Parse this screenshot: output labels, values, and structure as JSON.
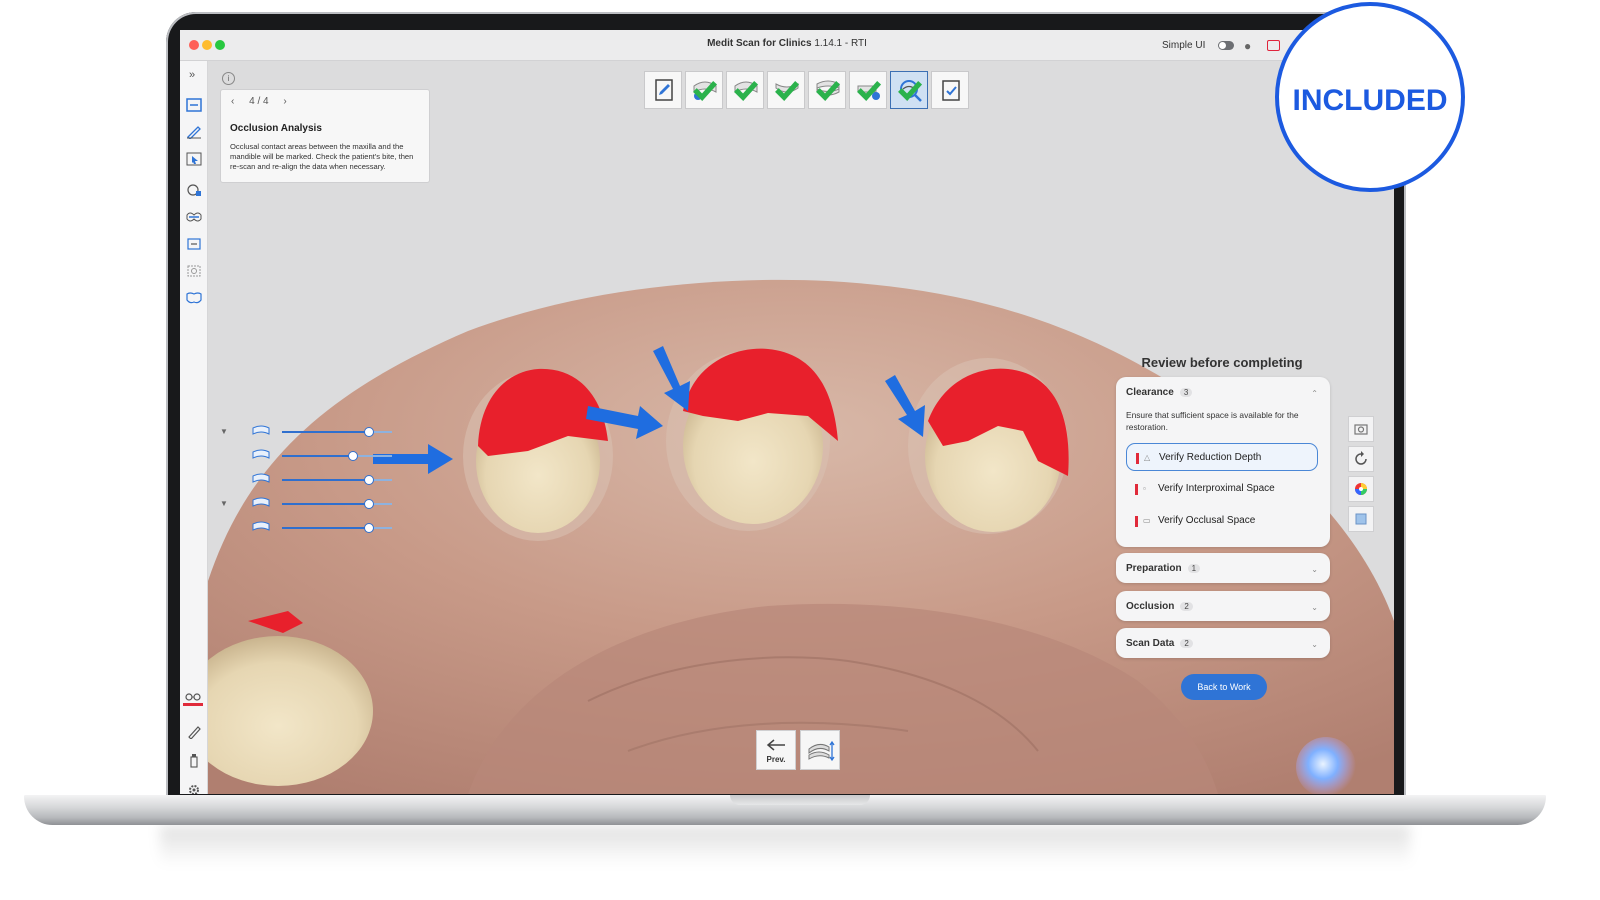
{
  "window": {
    "title_bold": "Medit Scan for Clinics",
    "title_rest": "1.14.1 - RTI",
    "simple_ui_label": "Simple UI",
    "traffic_lights": [
      "#fe5f57",
      "#febc2e",
      "#28c840"
    ]
  },
  "sidebar": {
    "expand_icon": "»",
    "top_items": [
      "scan-icon",
      "edit-icon",
      "select-icon",
      "align-icon",
      "occlusion-icon",
      "bite-icon",
      "screenshot-icon",
      "teeth-icon"
    ],
    "bottom_items": [
      "link-icon",
      "ruler-icon",
      "bottle-icon",
      "settings-icon"
    ]
  },
  "tip": {
    "info_icon": "i",
    "page": "4 / 4",
    "title": "Occlusion Analysis",
    "text": "Occlusal contact areas between the maxilla and the mandible will be marked. Check the patient's bite, then re-scan and re-align the data when necessary."
  },
  "workflow": {
    "steps": [
      {
        "icon": "notepad-icon",
        "done": false,
        "active": false
      },
      {
        "icon": "prep-maxilla-icon",
        "done": true,
        "active": false
      },
      {
        "icon": "maxilla-icon",
        "done": true,
        "active": false
      },
      {
        "icon": "mandible-icon",
        "done": true,
        "active": false
      },
      {
        "icon": "occlusion-icon",
        "done": true,
        "active": false
      },
      {
        "icon": "scanbody-icon",
        "done": true,
        "active": false
      },
      {
        "icon": "analysis-icon",
        "done": true,
        "active": true
      },
      {
        "icon": "clipboard-check-icon",
        "done": false,
        "active": false
      }
    ]
  },
  "sliders": [
    {
      "icon": "maxilla-prep-icon",
      "value": 1.0
    },
    {
      "icon": "maxilla-icon",
      "value": 0.6
    },
    {
      "icon": "mandible-icon",
      "value": 1.0
    },
    {
      "icon": "occlusion-icon",
      "value": 1.0
    },
    {
      "icon": "mandible-prep-icon",
      "value": 1.0
    }
  ],
  "review": {
    "title": "Review before completing",
    "clearance": {
      "label": "Clearance",
      "count": "3",
      "description": "Ensure that sufficient space is available for the restoration.",
      "items": [
        "Verify Reduction Depth",
        "Verify Interproximal Space",
        "Verify Occlusal Space"
      ]
    },
    "preparation": {
      "label": "Preparation",
      "count": "1"
    },
    "occlusion": {
      "label": "Occlusion",
      "count": "2"
    },
    "scan_data": {
      "label": "Scan Data",
      "count": "2"
    },
    "back_button": "Back to Work"
  },
  "bottom": {
    "prev_label": "Prev."
  },
  "badge": {
    "text": "INCLUDED",
    "color": "#1c5ae0"
  },
  "colors": {
    "accent": "#2f74d6",
    "contact_red": "#e8202c",
    "annotation_arrow": "#1f6de0"
  }
}
